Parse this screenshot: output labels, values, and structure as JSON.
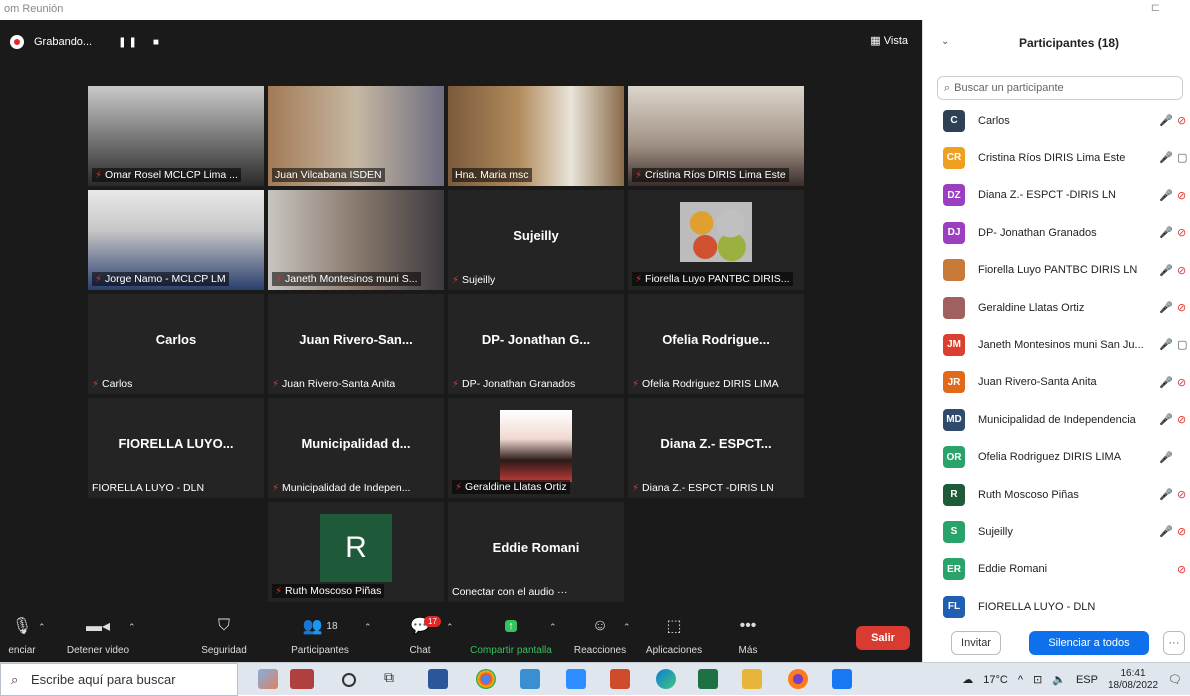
{
  "window": {
    "title": "om Reunión"
  },
  "meeting": {
    "recording_label": "Grabando...",
    "view_label": "Vista",
    "tiles": [
      {
        "caption": "Omar Rosel MCLCP Lima ...",
        "bigname": "",
        "video": "person-glasses",
        "muted": true
      },
      {
        "caption": "Juan Vilcabana ISDEN",
        "bigname": "",
        "video": "person-office",
        "muted": false
      },
      {
        "caption": "Hna. Maria msc",
        "bigname": "",
        "video": "person-room",
        "muted": false,
        "active": true
      },
      {
        "caption": "Cristina Ríos DIRIS Lima Este",
        "bigname": "",
        "video": "person-woman",
        "muted": true
      },
      {
        "caption": "Jorge Namo - MCLCP LM",
        "bigname": "",
        "video": "person-man",
        "muted": true
      },
      {
        "caption": "Janeth Montesinos muni S...",
        "bigname": "",
        "video": "person-books",
        "muted": true
      },
      {
        "caption": "Sujeilly",
        "bigname": "Sujeilly",
        "video": "",
        "muted": true
      },
      {
        "caption": "Fiorella Luyo PANTBC DIRIS...",
        "bigname": "",
        "video": "food",
        "muted": true
      },
      {
        "caption": "Carlos",
        "bigname": "Carlos",
        "video": "",
        "muted": true
      },
      {
        "caption": "Juan Rivero-Santa Anita",
        "bigname": "Juan  Rivero-San...",
        "video": "",
        "muted": true
      },
      {
        "caption": "DP- Jonathan Granados",
        "bigname": "DP-  Jonathan  G...",
        "video": "",
        "muted": true
      },
      {
        "caption": "Ofelia Rodriguez DIRIS LIMA",
        "bigname": "Ofelia  Rodrigue...",
        "video": "",
        "muted": true
      },
      {
        "caption": "FIORELLA LUYO - DLN",
        "bigname": "FIORELLA  LUYO...",
        "video": "",
        "muted": false
      },
      {
        "caption": "Municipalidad de Indepen...",
        "bigname": "Municipalidad  d...",
        "video": "",
        "muted": true
      },
      {
        "caption": "Geraldine Llatas Ortiz",
        "bigname": "",
        "video": "photo",
        "muted": true
      },
      {
        "caption": "Diana Z.- ESPCT -DIRIS LN",
        "bigname": "Diana  Z.-  ESPCT...",
        "video": "",
        "muted": true
      },
      {
        "caption": "Ruth Moscoso Piñas",
        "bigname": "",
        "video": "initial-R",
        "muted": true,
        "initial": "R"
      },
      {
        "caption": "Conectar con el audio ···",
        "bigname": "Eddie Romani",
        "video": "",
        "muted": false
      }
    ]
  },
  "toolbar": {
    "audio_label": "enciar",
    "video_label": "Detener video",
    "security_label": "Seguridad",
    "participants_label": "Participantes",
    "participants_count": "18",
    "chat_label": "Chat",
    "chat_badge": "17",
    "share_label": "Compartir pantalla",
    "reactions_label": "Reacciones",
    "apps_label": "Aplicaciones",
    "more_label": "Más",
    "leave_label": "Salir"
  },
  "panel": {
    "title": "Participantes (18)",
    "search_placeholder": "Buscar un participante",
    "participants": [
      {
        "initials": "C",
        "name": "Carlos",
        "color": "#2f3f55",
        "mic": "muted",
        "cam": "off"
      },
      {
        "initials": "CR",
        "name": "Cristina Ríos DIRIS Lima Este",
        "color": "#f0a020",
        "mic": "muted",
        "cam": "on"
      },
      {
        "initials": "DZ",
        "name": "Diana Z.- ESPCT -DIRIS LN",
        "color": "#9b3fc0",
        "mic": "muted",
        "cam": "off"
      },
      {
        "initials": "DJ",
        "name": "DP- Jonathan Granados",
        "color": "#9b3fc0",
        "mic": "muted",
        "cam": "off"
      },
      {
        "initials": "",
        "name": "Fiorella Luyo PANTBC DIRIS LN",
        "color": "#c77a3a",
        "mic": "muted",
        "cam": "off"
      },
      {
        "initials": "",
        "name": "Geraldine Llatas Ortiz",
        "color": "#a06060",
        "mic": "muted",
        "cam": "off"
      },
      {
        "initials": "JM",
        "name": "Janeth Montesinos muni San Ju...",
        "color": "#d9402f",
        "mic": "muted",
        "cam": "on"
      },
      {
        "initials": "JR",
        "name": "Juan Rivero-Santa Anita",
        "color": "#e06a1a",
        "mic": "muted",
        "cam": "off"
      },
      {
        "initials": "MD",
        "name": "Municipalidad de Independencia",
        "color": "#2f4a6a",
        "mic": "muted",
        "cam": "off"
      },
      {
        "initials": "OR",
        "name": "Ofelia Rodriguez DIRIS LIMA",
        "color": "#2aa36a",
        "mic": "muted",
        "cam": ""
      },
      {
        "initials": "R",
        "name": "Ruth Moscoso Piñas",
        "color": "#1f5a3a",
        "mic": "muted",
        "cam": "off"
      },
      {
        "initials": "S",
        "name": "Sujeilly",
        "color": "#2aa36a",
        "mic": "muted",
        "cam": "off"
      },
      {
        "initials": "ER",
        "name": "Eddie Romani",
        "color": "#2aa36a",
        "mic": "",
        "cam": "off"
      },
      {
        "initials": "FL",
        "name": "FIORELLA LUYO - DLN",
        "color": "#1f5fb0",
        "mic": "",
        "cam": ""
      }
    ],
    "invite_label": "Invitar",
    "mute_all_label": "Silenciar a todos",
    "more_label": "···"
  },
  "taskbar": {
    "search_placeholder": "Escribe aquí para buscar",
    "temperature": "17°C",
    "language": "ESP",
    "time": "16:41",
    "date": "18/08/2022"
  }
}
